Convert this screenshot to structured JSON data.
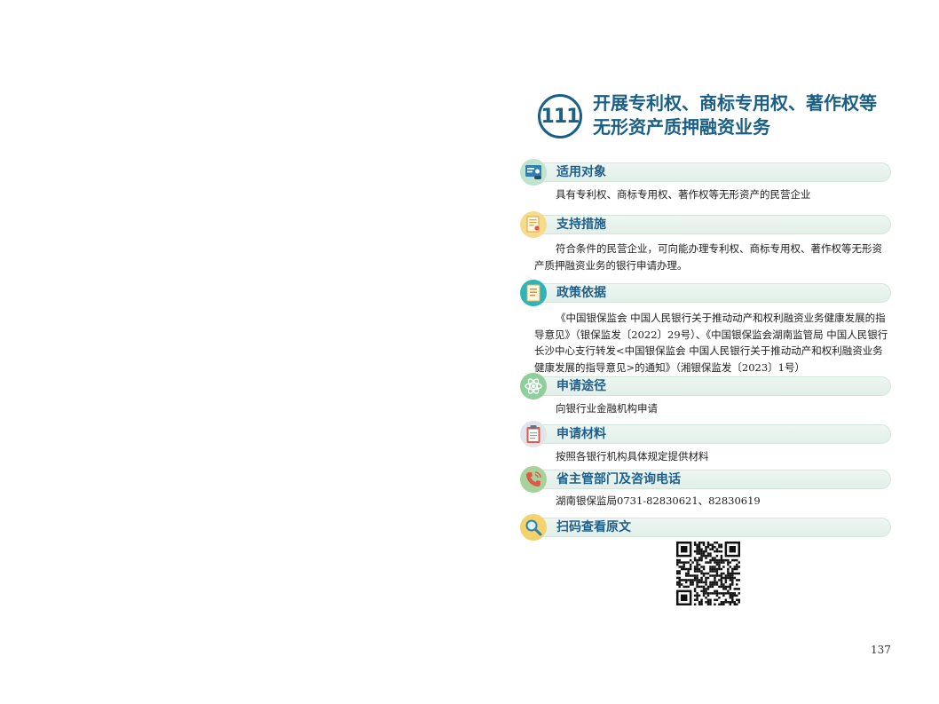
{
  "header": {
    "number": "111",
    "title_line1": "开展专利权、商标专用权、著作权等",
    "title_line2": "无形资产质押融资业务"
  },
  "sections": {
    "target": {
      "label": "适用对象",
      "text": "具有专利权、商标专用权、著作权等无形资产的民营企业"
    },
    "measures": {
      "label": "支持措施",
      "text": "符合条件的民营企业，可向能办理专利权、商标专用权、著作权等无形资产质押融资业务的银行申请办理。"
    },
    "basis": {
      "label": "政策依据",
      "text": "《中国银保监会 中国人民银行关于推动动产和权利融资业务健康发展的指导意见》（银保监发〔2022〕29号）、《中国银保监会湖南监管局 中国人民银行长沙中心支行转发<中国银保监会 中国人民银行关于推动动产和权利融资业务健康发展的指导意见>的通知》（湘银保监发〔2023〕1号）"
    },
    "channel": {
      "label": "申请途径",
      "text": "向银行业金融机构申请"
    },
    "materials": {
      "label": "申请材料",
      "text": "按照各银行机构具体规定提供材料"
    },
    "contact": {
      "label": "省主管部门及咨询电话",
      "text": "湖南银保监局0731-82830621、82830619"
    },
    "scan": {
      "label": "扫码查看原文"
    }
  },
  "page_number": "137",
  "colors": {
    "title": "#1a5f86",
    "label": "#1f5f8b",
    "bar_bg": "#e8f3ee"
  },
  "icons": [
    "profile-card-icon",
    "certificate-icon",
    "document-icon",
    "atom-icon",
    "clipboard-icon",
    "phone-icon",
    "magnifier-icon",
    "qr-code-icon"
  ]
}
